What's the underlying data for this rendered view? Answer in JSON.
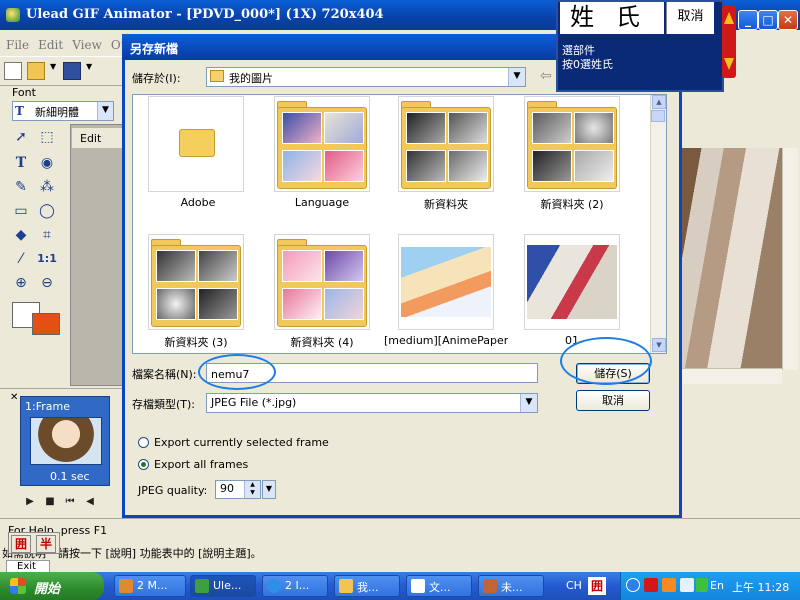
{
  "app": {
    "title": "Ulead GIF Animator - [PDVD_000*] (1X) 720x404",
    "menu": [
      "File",
      "Edit",
      "View",
      "Ot"
    ],
    "font_label": "Font",
    "font_value": "新細明體",
    "edit_tab": "Edit",
    "status": "For Help, press F1",
    "hint": "請按一下 [說明] 功能表中的 [說明主題]。",
    "hint_prefix": "如需說明",
    "exit_label": "Exit",
    "ime_keys": [
      "囲",
      "半"
    ]
  },
  "frames": [
    {
      "label": "1:Frame",
      "delay": "0.1 sec"
    }
  ],
  "dialog": {
    "title": "另存新檔",
    "save_in_label": "儲存於(I):",
    "save_in_value": "我的圖片",
    "files": [
      {
        "name": "Adobe",
        "kind": "folder-empty"
      },
      {
        "name": "Language",
        "kind": "folder-pics"
      },
      {
        "name": "新資料夾",
        "kind": "folder-pics"
      },
      {
        "name": "新資料夾 (2)",
        "kind": "folder-pics"
      },
      {
        "name": "新資料夾 (3)",
        "kind": "folder-pics"
      },
      {
        "name": "新資料夾 (4)",
        "kind": "folder-pics"
      },
      {
        "name": "[medium][AnimePaper]...",
        "kind": "image"
      },
      {
        "name": "01",
        "kind": "image"
      }
    ],
    "filename_label": "檔案名稱(N):",
    "filename_value": "nemu7",
    "filetype_label": "存檔類型(T):",
    "filetype_value": "JPEG File (*.jpg)",
    "save_button": "儲存(S)",
    "cancel_button": "取消",
    "export_options": [
      {
        "label": "Export currently selected frame",
        "selected": false
      },
      {
        "label": "Export all frames",
        "selected": true
      }
    ],
    "quality_label": "JPEG quality:",
    "quality_value": "90"
  },
  "ime_candidate": {
    "chars": "姓氏",
    "cancel": "取消",
    "line1": "選部件",
    "line2": "按0選姓氏"
  },
  "taskbar": {
    "start": "開始",
    "tasks": [
      "2 M...",
      "Ule...",
      "2 I...",
      "我...",
      "文...",
      "未..."
    ],
    "lang": "CH",
    "en": "En",
    "time": "上午 11:28"
  },
  "colors": {
    "xp_blue": "#0a46c4",
    "background_color": "#e35013",
    "annotation": "#1a7ee6"
  }
}
